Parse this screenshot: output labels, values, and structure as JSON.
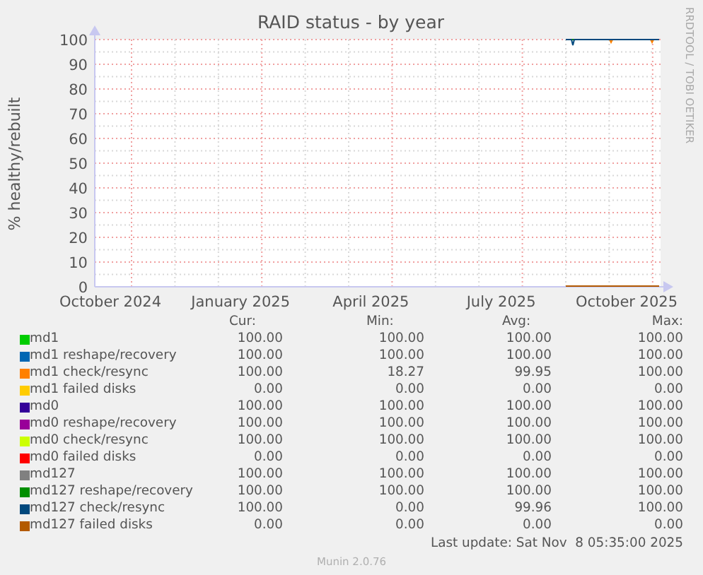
{
  "title": "RAID status - by year",
  "watermark": "RRDTOOL / TOBI OETIKER",
  "chart": {
    "ylabel": "% healthy/rebuilt",
    "y_ticks": [
      "100",
      "90",
      "80",
      "70",
      "60",
      "50",
      "40",
      "30",
      "20",
      "10",
      "0"
    ],
    "x_ticks": [
      "October 2024",
      "January 2025",
      "April 2025",
      "July 2025",
      "October 2025"
    ]
  },
  "legend_headers": [
    "Cur:",
    "Min:",
    "Avg:",
    "Max:"
  ],
  "legend": [
    {
      "name": "md1",
      "color": "#00cc00",
      "cur": "100.00",
      "min": "100.00",
      "avg": "100.00",
      "max": "100.00"
    },
    {
      "name": "md1 reshape/recovery",
      "color": "#0066b3",
      "cur": "100.00",
      "min": "100.00",
      "avg": "100.00",
      "max": "100.00"
    },
    {
      "name": "md1 check/resync",
      "color": "#ff8000",
      "cur": "100.00",
      "min": "18.27",
      "avg": "99.95",
      "max": "100.00"
    },
    {
      "name": "md1 failed disks",
      "color": "#ffcc00",
      "cur": "0.00",
      "min": "0.00",
      "avg": "0.00",
      "max": "0.00"
    },
    {
      "name": "md0",
      "color": "#330099",
      "cur": "100.00",
      "min": "100.00",
      "avg": "100.00",
      "max": "100.00"
    },
    {
      "name": "md0 reshape/recovery",
      "color": "#990099",
      "cur": "100.00",
      "min": "100.00",
      "avg": "100.00",
      "max": "100.00"
    },
    {
      "name": "md0 check/resync",
      "color": "#ccff00",
      "cur": "100.00",
      "min": "100.00",
      "avg": "100.00",
      "max": "100.00"
    },
    {
      "name": "md0 failed disks",
      "color": "#ff0000",
      "cur": "0.00",
      "min": "0.00",
      "avg": "0.00",
      "max": "0.00"
    },
    {
      "name": "md127",
      "color": "#808080",
      "cur": "100.00",
      "min": "100.00",
      "avg": "100.00",
      "max": "100.00"
    },
    {
      "name": "md127 reshape/recovery",
      "color": "#008f00",
      "cur": "100.00",
      "min": "100.00",
      "avg": "100.00",
      "max": "100.00"
    },
    {
      "name": "md127 check/resync",
      "color": "#00487d",
      "cur": "100.00",
      "min": "0.00",
      "avg": "99.96",
      "max": "100.00"
    },
    {
      "name": "md127 failed disks",
      "color": "#b35a00",
      "cur": "0.00",
      "min": "0.00",
      "avg": "0.00",
      "max": "0.00"
    }
  ],
  "last_update": "Last update: Sat Nov  8 05:35:00 2025",
  "footer": "Munin 2.0.76"
}
